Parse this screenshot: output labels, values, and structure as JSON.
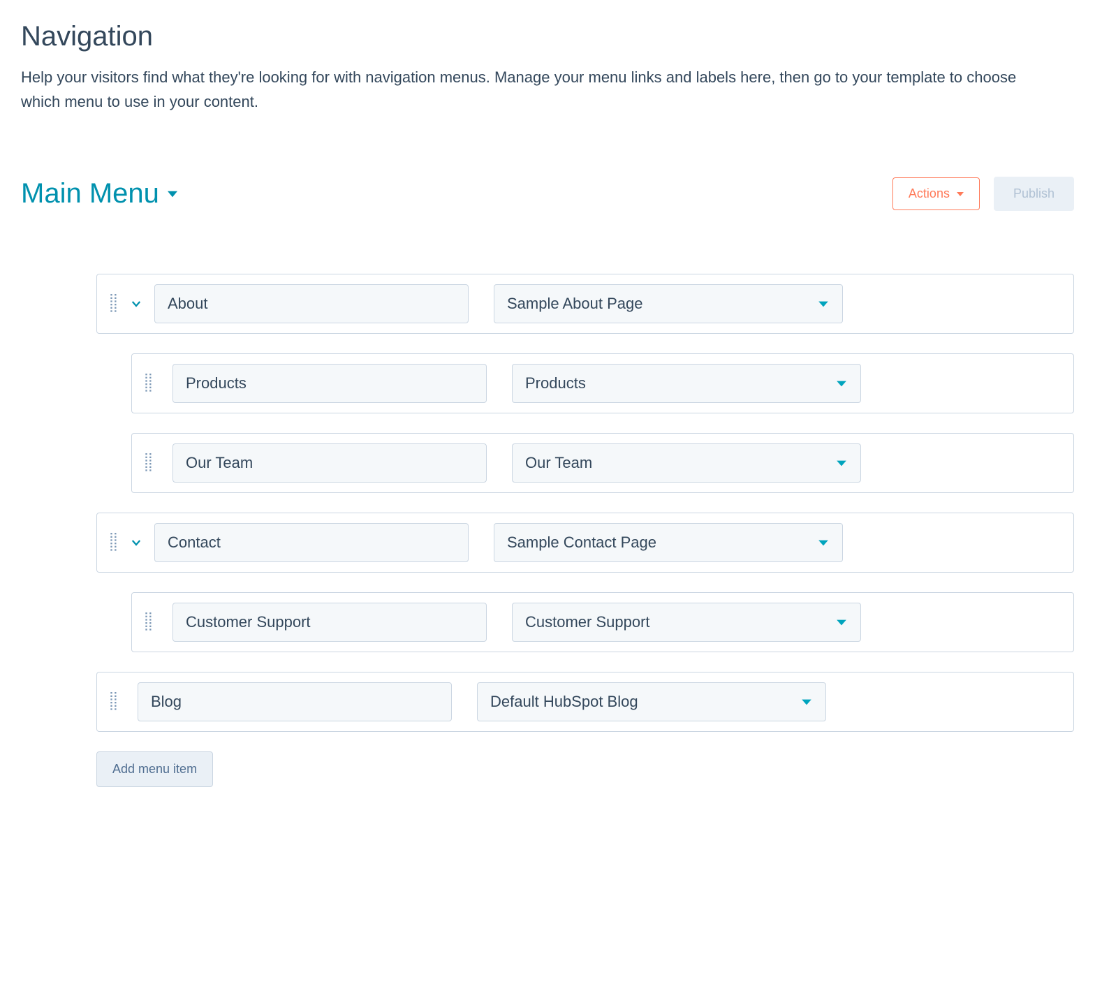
{
  "page": {
    "title": "Navigation",
    "description": "Help your visitors find what they're looking for with navigation menus. Manage your menu links and labels here, then go to your template to choose which menu to use in your content."
  },
  "header": {
    "menuName": "Main Menu",
    "actionsLabel": "Actions",
    "publishLabel": "Publish"
  },
  "items": [
    {
      "level": 0,
      "expandable": true,
      "label": "About",
      "page": "Sample About Page"
    },
    {
      "level": 1,
      "expandable": false,
      "label": "Products",
      "page": "Products"
    },
    {
      "level": 1,
      "expandable": false,
      "label": "Our Team",
      "page": "Our Team"
    },
    {
      "level": 0,
      "expandable": true,
      "label": "Contact",
      "page": "Sample Contact Page"
    },
    {
      "level": 1,
      "expandable": false,
      "label": "Customer Support",
      "page": "Customer Support"
    },
    {
      "level": 0,
      "expandable": false,
      "label": "Blog",
      "page": "Default HubSpot Blog"
    }
  ],
  "addButton": {
    "label": "Add menu item"
  },
  "colors": {
    "accentTeal": "#0091ae",
    "accentOrange": "#ff7a59",
    "border": "#cbd6e2",
    "muted": "#eaf0f6",
    "text": "#33475b"
  }
}
